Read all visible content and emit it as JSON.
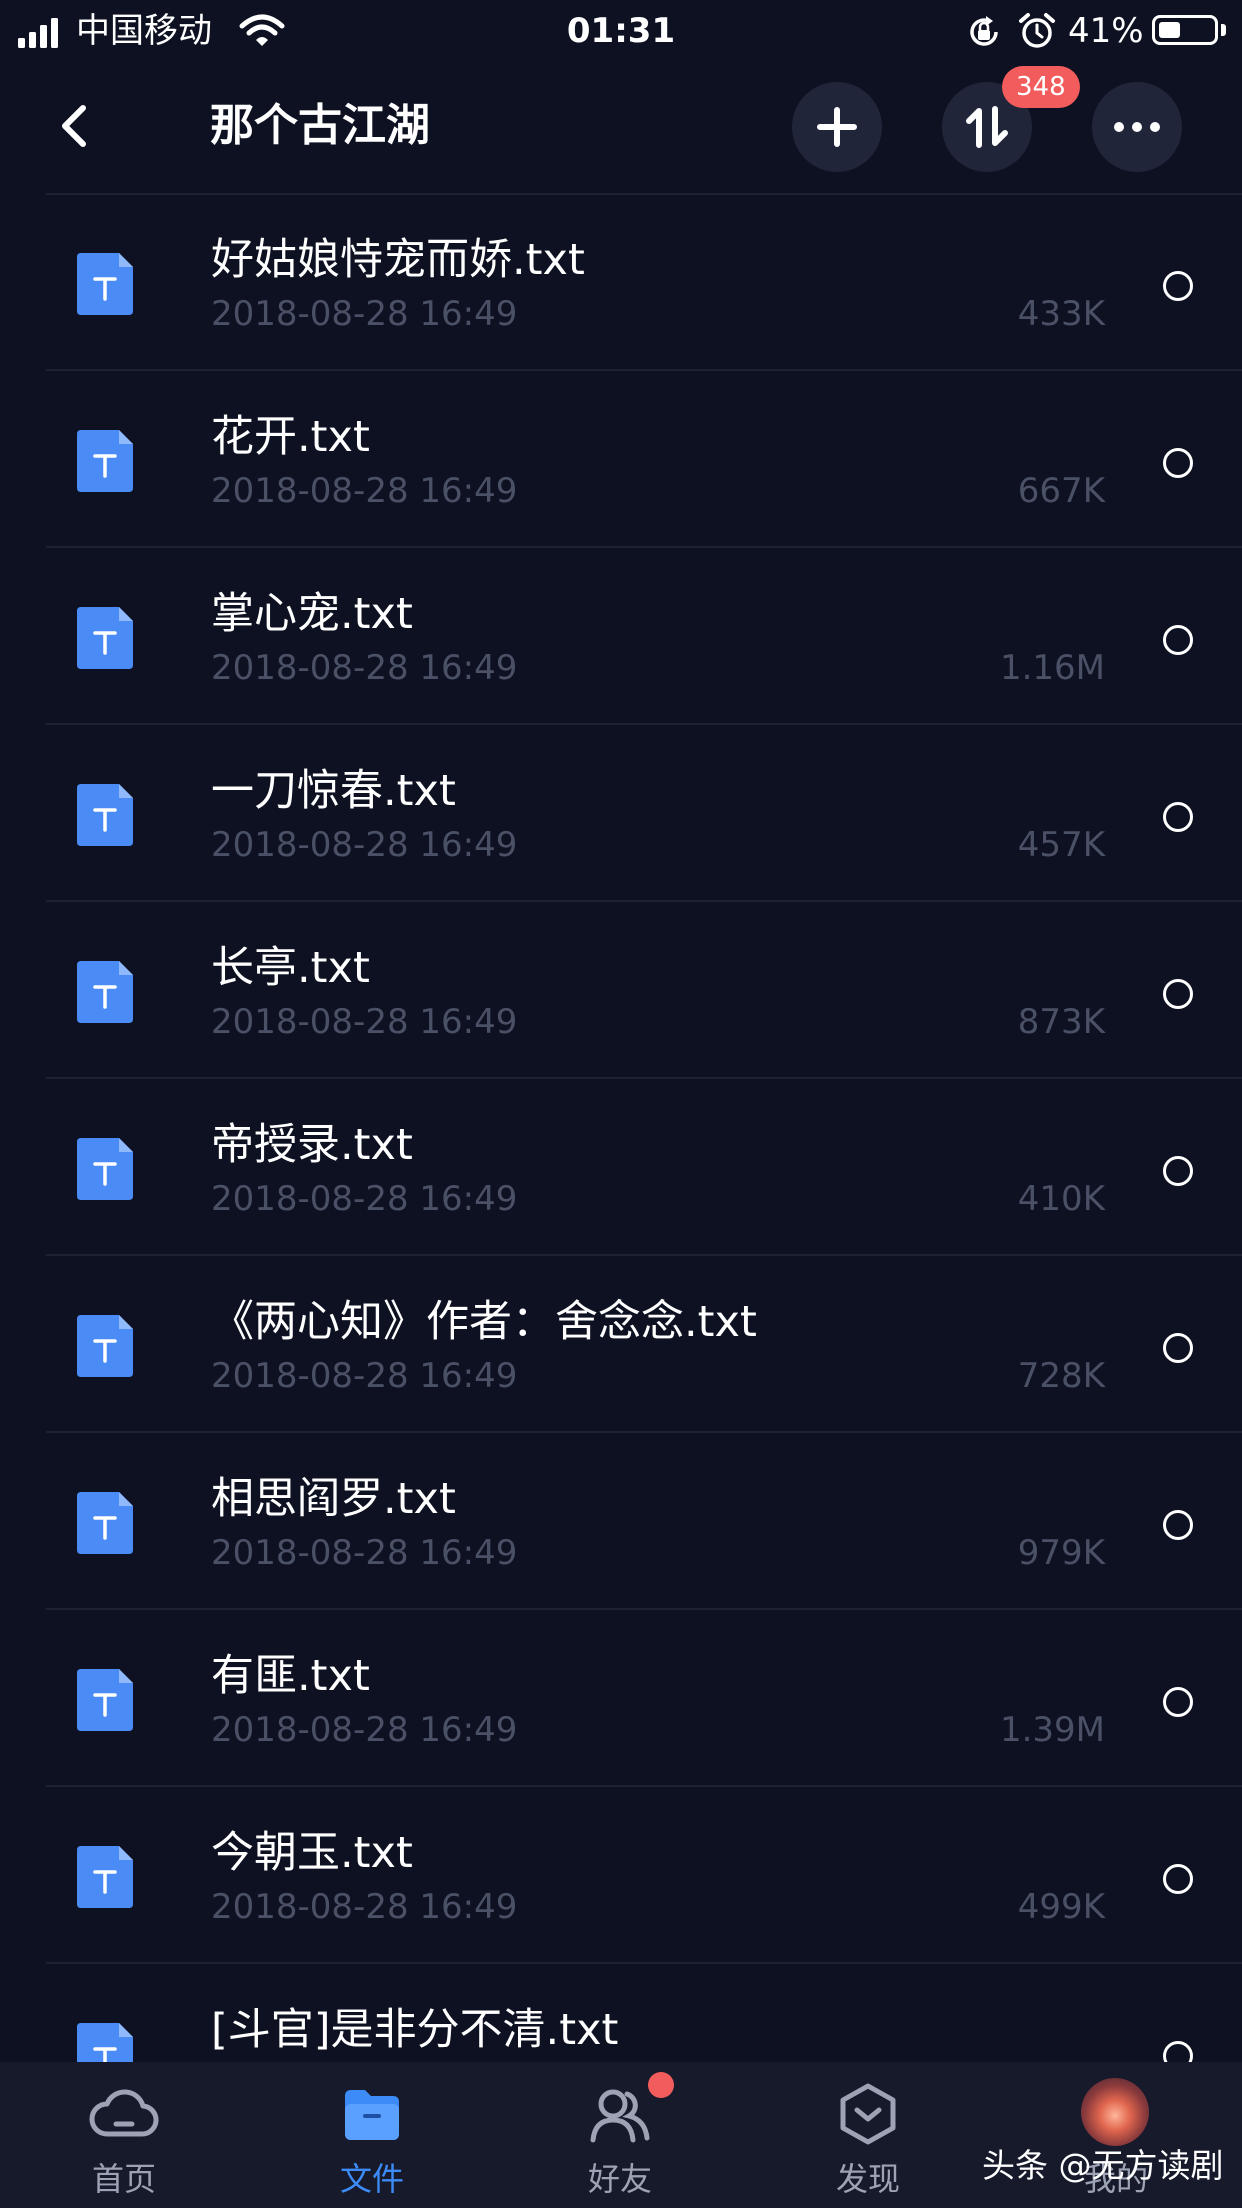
{
  "status_bar": {
    "carrier": "中国移动",
    "time": "01:31",
    "battery_percent": "41%",
    "battery_level": 0.41
  },
  "header": {
    "title": "那个古江湖",
    "transfer_badge": "348",
    "icons": [
      "back-icon",
      "add-icon",
      "transfer-icon",
      "more-icon"
    ]
  },
  "files": [
    {
      "name": "好姑娘恃宠而娇.txt",
      "date": "2018-08-28 16:49",
      "size": "433K"
    },
    {
      "name": "花开.txt",
      "date": "2018-08-28 16:49",
      "size": "667K"
    },
    {
      "name": "掌心宠.txt",
      "date": "2018-08-28 16:49",
      "size": "1.16M"
    },
    {
      "name": "一刀惊春.txt",
      "date": "2018-08-28 16:49",
      "size": "457K"
    },
    {
      "name": "长亭.txt",
      "date": "2018-08-28 16:49",
      "size": "873K"
    },
    {
      "name": "帝授录.txt",
      "date": "2018-08-28 16:49",
      "size": "410K"
    },
    {
      "name": "《两心知》作者：舍念念.txt",
      "date": "2018-08-28 16:49",
      "size": "728K"
    },
    {
      "name": "相思阎罗.txt",
      "date": "2018-08-28 16:49",
      "size": "979K"
    },
    {
      "name": "有匪.txt",
      "date": "2018-08-28 16:49",
      "size": "1.39M"
    },
    {
      "name": "今朝玉.txt",
      "date": "2018-08-28 16:49",
      "size": "499K"
    },
    {
      "name": "[斗官]是非分不清.txt",
      "date": "",
      "size": ""
    }
  ],
  "tabs": [
    {
      "label": "首页",
      "icon": "cloud-icon"
    },
    {
      "label": "文件",
      "icon": "folder-icon",
      "active": true
    },
    {
      "label": "好友",
      "icon": "friends-icon"
    },
    {
      "label": "发现",
      "icon": "discover-icon"
    },
    {
      "label": "我的",
      "icon": "avatar"
    }
  ],
  "watermark": "头条 @无方读剧",
  "colors": {
    "background": "#0d1121",
    "accent": "#3d8bf7",
    "badge": "#f25c5c",
    "secondary_text": "#4a5066"
  }
}
